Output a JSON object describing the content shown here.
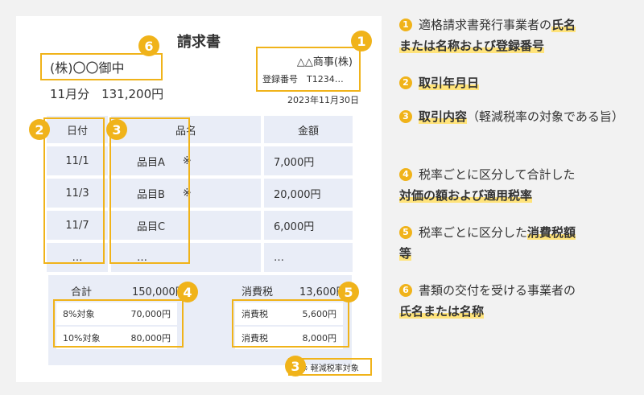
{
  "invoice": {
    "title": "請求書",
    "recipient": "(株)〇〇御中",
    "amount_line": "11月分　131,200円",
    "issuer_name": "△△商事(株)",
    "registration": "登録番号　T1234…",
    "date": "2023年11月30日",
    "headers": {
      "date": "日付",
      "item": "品名",
      "price": "金額"
    },
    "rows": [
      {
        "date": "11/1",
        "item": "品目A",
        "mark": "※",
        "price": "7,000円"
      },
      {
        "date": "11/3",
        "item": "品目B",
        "mark": "※",
        "price": "20,000円"
      },
      {
        "date": "11/7",
        "item": "品目C",
        "mark": "",
        "price": "6,000円"
      },
      {
        "date": "…",
        "item": "…",
        "mark": "",
        "price": "…"
      }
    ],
    "total_label": "合計",
    "total_value": "150,000円",
    "tax_label": "消費税",
    "tax_value": "13,600円",
    "breakdown": [
      {
        "label": "8%対象",
        "value": "70,000円",
        "tax_label": "消費税",
        "tax_value": "5,600円"
      },
      {
        "label": "10%対象",
        "value": "80,000円",
        "tax_label": "消費税",
        "tax_value": "8,000円"
      }
    ],
    "reduced_note": "※ 軽減税率対象"
  },
  "badges": [
    "1",
    "2",
    "3",
    "4",
    "5",
    "6"
  ],
  "points": [
    {
      "num": "1",
      "pre": "適格請求書発行事業者の",
      "hl1": "氏名",
      "mid": "",
      "hl2": "または名称および登録番号",
      "post": ""
    },
    {
      "num": "2",
      "hl1": "取引年月日"
    },
    {
      "num": "3",
      "hl1": "取引内容",
      "post": "（軽減税率の対象である旨）"
    },
    {
      "num": "4",
      "pre": "税率ごとに区分して合計した",
      "hl1": "対価の額および適用税率"
    },
    {
      "num": "5",
      "pre": "税率ごとに区分した",
      "hl1": "消費税額",
      "hl2": "等"
    },
    {
      "num": "6",
      "pre": "書類の交付を受ける事業者の",
      "hl1": "氏名または名称"
    }
  ],
  "colors": {
    "accent": "#f0b31a",
    "cell": "#e9edf7",
    "highlight": "#ffe37a"
  }
}
